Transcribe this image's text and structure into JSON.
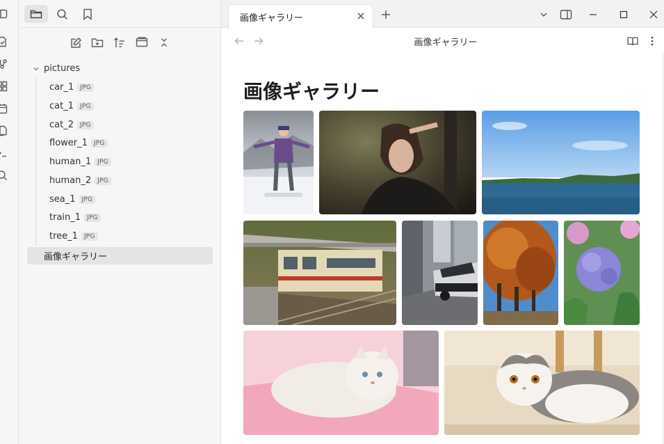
{
  "sidebar": {
    "folder": {
      "name": "pictures"
    },
    "files": [
      {
        "name": "car_1",
        "ext": "JPG"
      },
      {
        "name": "cat_1",
        "ext": "JPG"
      },
      {
        "name": "cat_2",
        "ext": "JPG"
      },
      {
        "name": "flower_1",
        "ext": "JPG"
      },
      {
        "name": "human_1",
        "ext": "JPG"
      },
      {
        "name": "human_2",
        "ext": "JPG"
      },
      {
        "name": "sea_1",
        "ext": "JPG"
      },
      {
        "name": "train_1",
        "ext": "JPG"
      },
      {
        "name": "tree_1",
        "ext": "JPG"
      }
    ],
    "active_note": "画像ギャラリー"
  },
  "tab": {
    "title": "画像ギャラリー"
  },
  "view": {
    "title": "画像ギャラリー"
  },
  "note": {
    "title": "画像ギャラリー"
  },
  "colors": {
    "accent": "#7c5cff",
    "selected_bg": "#e4e4e4",
    "icon": "#5c5c5c"
  }
}
